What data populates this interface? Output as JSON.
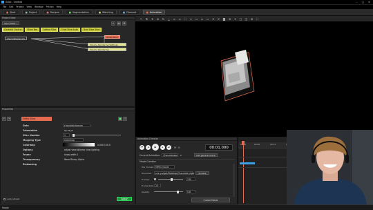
{
  "window": {
    "title": "Avizo - Untitled",
    "controls": [
      "–",
      "□",
      "×"
    ]
  },
  "menu": [
    "File",
    "Edit",
    "Project",
    "View",
    "Window",
    "Python",
    "Help"
  ],
  "tabs": [
    {
      "label": "Start"
    },
    {
      "label": "Project"
    },
    {
      "label": "Recipes"
    },
    {
      "label": "Segmentation"
    },
    {
      "label": "Watching"
    },
    {
      "label": "Filament"
    },
    {
      "label": "Animation"
    }
  ],
  "project_view": {
    "title": "Project View",
    "open_data": "Open Data...",
    "buttons": [
      "Contrast Control",
      "Show Box",
      "Lattice Slice",
      "Dual Slice Auto",
      "Dual Slice Slice"
    ],
    "nodes": [
      "chocolate.bar.am",
      "Ortho Slice",
      "Volume Rendering Settings",
      "Volume Rendering"
    ]
  },
  "properties": {
    "title": "Properties",
    "module": "Ortho Slice",
    "rows": [
      {
        "label": "Data",
        "value": "chocolate.bar.am"
      },
      {
        "label": "Orientation",
        "value": "xy   xz   yz"
      },
      {
        "label": "Slice Number",
        "value": "1"
      },
      {
        "label": "Mapping Type",
        "value": "Colormap"
      },
      {
        "label": "Colormap",
        "value": "0.000   100.0"
      },
      {
        "label": "Options",
        "value": "adjust view   bilinear view   lighting"
      },
      {
        "label": "Frame",
        "value": "show   width   1"
      },
      {
        "label": "Transparency",
        "value": "None   Binary   Alpha"
      },
      {
        "label": "Embossing",
        "value": ""
      }
    ],
    "auto_refresh": "auto-refresh",
    "apply": "Apply"
  },
  "animation": {
    "title": "Animation Director",
    "current_animation_label": "Current Animation:",
    "current_animation": "Chocolatebar",
    "add_event": "Add general event",
    "time": "00:01.000",
    "movie_creation": "Movie Creation",
    "fields": [
      {
        "label": "File Format:",
        "value": "MPEG movie"
      },
      {
        "label": "Filename:",
        "value": "ene.yadget/Desktop/Chocolate.mpg"
      },
      {
        "label": "Frames:",
        "value": "130"
      },
      {
        "label": "Frame Rate:",
        "value": "25"
      },
      {
        "label": "Quality:",
        "value": "0.8"
      }
    ],
    "browse": "Browse",
    "create": "Create Movie",
    "ticks": [
      "00:00",
      "00:06",
      "00:12",
      "00:18",
      "00:24",
      "00:30",
      "00:36"
    ]
  },
  "status": "Ready",
  "colors": {
    "accent": "#e46b4f",
    "green": "#1b9c3a",
    "yellow": "#c8c836",
    "blue": "#3aa0e8"
  }
}
